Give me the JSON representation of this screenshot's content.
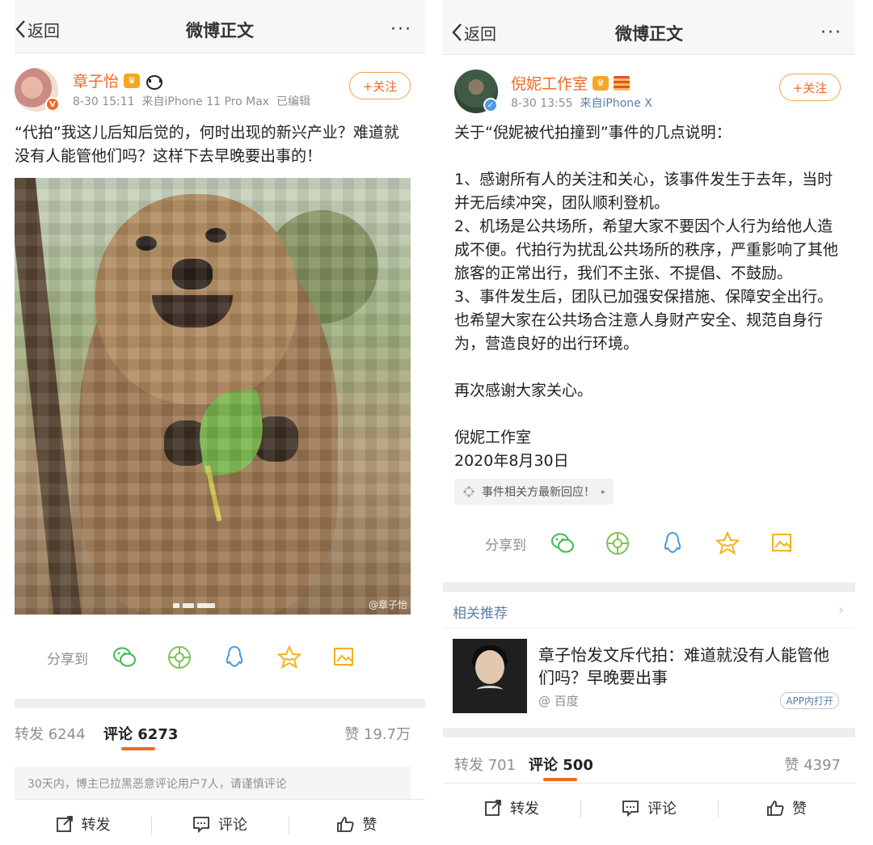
{
  "nav": {
    "back_label": "返回",
    "title": "微博正文",
    "more": "···"
  },
  "left": {
    "user": {
      "name": "章子怡",
      "badge": "V"
    },
    "meta": {
      "time": "8-30 15:11",
      "source": "来自iPhone 11 Pro Max",
      "edited": "已编辑"
    },
    "follow_label": "+关注",
    "text": "“代拍”我这儿后知后觉的，何时出现的新兴产业？难道就没有人能管他们吗？这样下去早晚要出事的！",
    "photo_watermark": "@章子怡",
    "share_label": "分享到",
    "stats": {
      "repost": "转发 6244",
      "comment": "评论 6273",
      "like": "赞 19.7万"
    },
    "notice": "30天内，博主已拉黑恶意评论用户7人，请谨慎评论",
    "bottom": {
      "repost": "转发",
      "comment": "评论",
      "like": "赞"
    }
  },
  "right": {
    "user": {
      "name": "倪妮工作室",
      "badge": "✓"
    },
    "meta": {
      "time": "8-30 13:55",
      "source": "来自iPhone X"
    },
    "follow_label": "+关注",
    "paragraphs": [
      "关于“倪妮被代拍撞到”事件的几点说明：",
      "",
      "1、感谢所有人的关注和关心，该事件发生于去年，当时并无后续冲突，团队顺利登机。",
      "2、机场是公共场所，希望大家不要因个人行为给他人造成不便。代拍行为扰乱公共场所的秩序，严重影响了其他旅客的正常出行，我们不主张、不提倡、不鼓励。",
      "3、事件发生后，团队已加强安保措施、保障安全出行。也希望大家在公共场合注意人身财产安全、规范自身行为，营造良好的出行环境。",
      "",
      "再次感谢大家关心。",
      "",
      "倪妮工作室",
      "2020年8月30日"
    ],
    "topic": "事件相关方最新回应！",
    "share_label": "分享到",
    "related": {
      "header": "相关推荐",
      "title": "章子怡发文斥代拍：难道就没有人能管他们吗？早晚要出事",
      "source": "@ 百度",
      "app_label": "APP内打开"
    },
    "stats": {
      "repost": "转发 701",
      "comment": "评论 500",
      "like": "赞 4397"
    },
    "bottom": {
      "repost": "转发",
      "comment": "评论",
      "like": "赞"
    }
  },
  "colors": {
    "accent": "#f2681f",
    "link": "#5b7ea8",
    "wechat": "#3fba4b",
    "moments": "#7fc350",
    "qq": "#4a9be0",
    "fav": "#f2b31b",
    "album": "#f2b31b"
  },
  "share_icons": [
    "wechat-icon",
    "moments-icon",
    "qq-icon",
    "favorite-star-icon",
    "album-icon"
  ]
}
